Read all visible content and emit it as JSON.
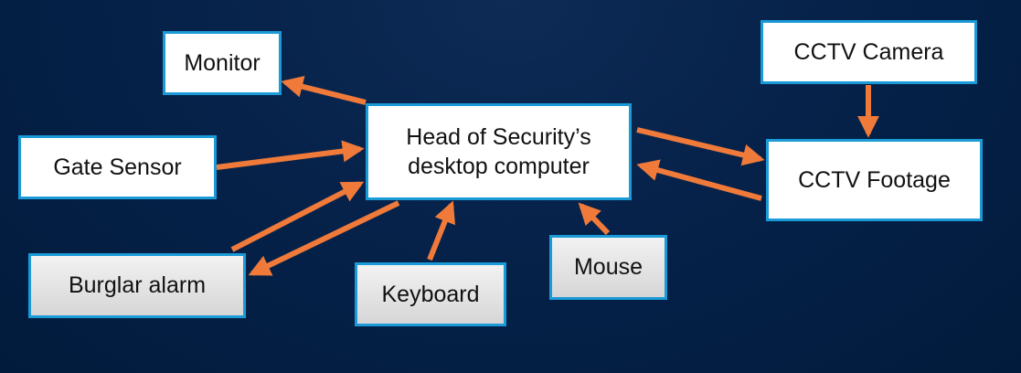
{
  "nodes": {
    "monitor": "Monitor",
    "head_line1": "Head of Security’s",
    "head_line2": "desktop computer",
    "gate_sensor": "Gate Sensor",
    "cctv_camera": "CCTV Camera",
    "cctv_footage": "CCTV Footage",
    "burglar_alarm": "Burglar alarm",
    "keyboard": "Keyboard",
    "mouse": "Mouse"
  },
  "colors": {
    "arrow": "#f07a3a",
    "border": "#1a9ad6",
    "background": "#06224a"
  }
}
